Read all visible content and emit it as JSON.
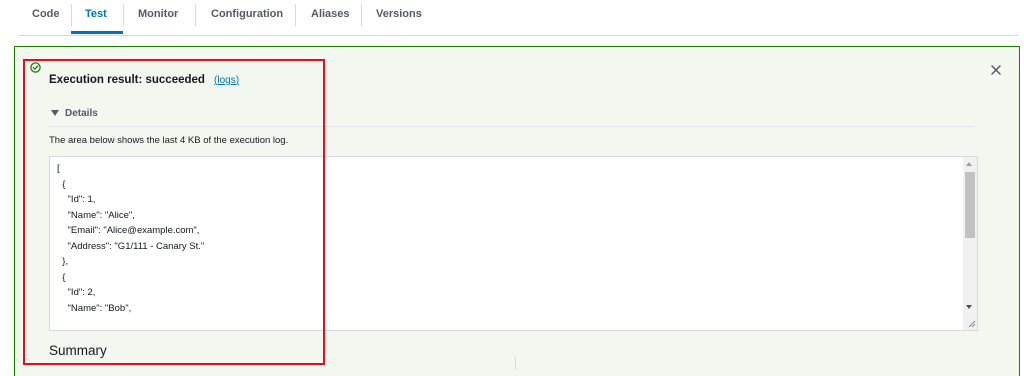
{
  "tabs": [
    {
      "label": "Code",
      "active": false
    },
    {
      "label": "Test",
      "active": true
    },
    {
      "label": "Monitor",
      "active": false
    },
    {
      "label": "Configuration",
      "active": false
    },
    {
      "label": "Aliases",
      "active": false
    },
    {
      "label": "Versions",
      "active": false
    }
  ],
  "result": {
    "title": "Execution result: succeeded",
    "logs_link": "logs",
    "status_icon": "check-circle-icon",
    "status_color": "#1d8102",
    "close_icon": "close-icon"
  },
  "details": {
    "toggle_label": "Details",
    "description": "The area below shows the last 4 KB of the execution log.",
    "log_lines": [
      "[",
      "  {",
      "    \"Id\": 1,",
      "    \"Name\": \"Alice\",",
      "    \"Email\": \"Alice@example.com\",",
      "    \"Address\": \"G1/111 - Canary St.\"",
      "  },",
      "  {",
      "    \"Id\": 2,",
      "    \"Name\": \"Bob\","
    ]
  },
  "summary": {
    "heading": "Summary"
  },
  "colors": {
    "accent": "#0073bb",
    "success": "#1d8102",
    "highlight": "#e0101f"
  }
}
